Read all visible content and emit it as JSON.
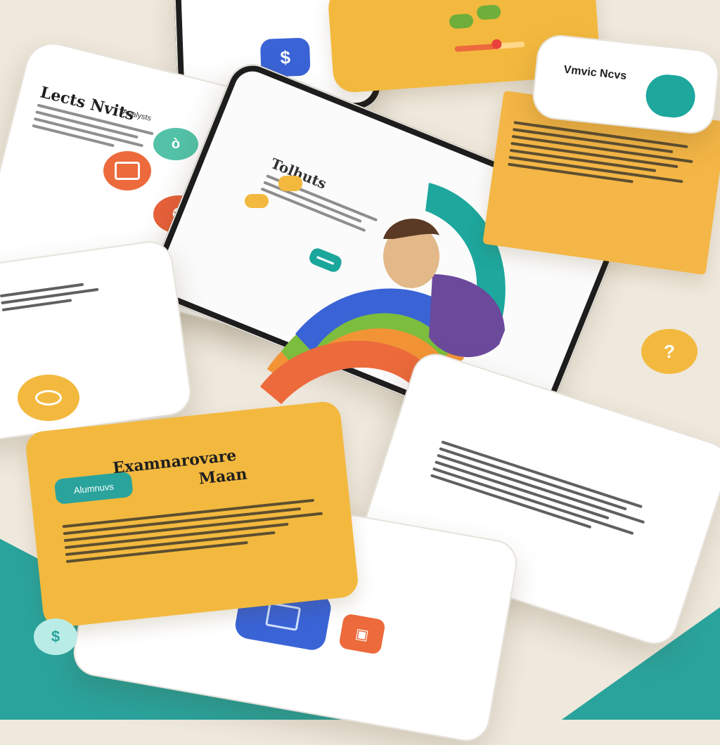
{
  "heading_topleft": "Lects Nvits",
  "subheading_topleft": "Analysts",
  "title_center_screen": "Tolhuts",
  "badge_bottom_left": "Alumnuvs",
  "title_bottom_left": "Examnarovare",
  "title_bottom_left_2": "Maan",
  "heading_right_card": "Vmvic Ncvs",
  "colors": {
    "teal": "#2aa39c",
    "yellow": "#f3b93f",
    "orange": "#ec6a3b",
    "blue": "#3a63d6",
    "purple": "#6b4a9c",
    "green": "#7cbd3d"
  },
  "icons": {
    "top_blue_button": "dollar-icon",
    "teal_circle": "chat-icon",
    "orange_circle_1": "card-icon",
    "orange_circle_2": "gift-icon",
    "yellow_circle": "eye-icon",
    "yellow_circle_right": "question-icon",
    "bottom_teal_circle": "dollar-icon"
  }
}
